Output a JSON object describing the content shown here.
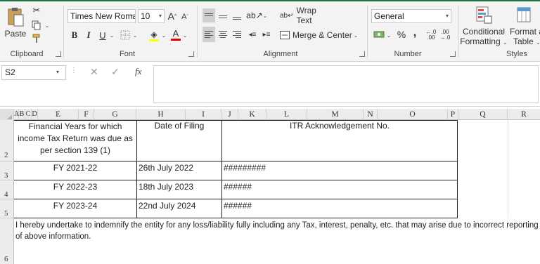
{
  "ribbon": {
    "clipboard": {
      "paste_label": "Paste",
      "group_label": "Clipboard"
    },
    "font": {
      "font_name": "Times New Romar",
      "font_size": "10",
      "bold": "B",
      "italic": "I",
      "underline": "U",
      "grow": "A",
      "shrink": "A",
      "group_label": "Font"
    },
    "alignment": {
      "wrap_text": "Wrap Text",
      "merge_center": "Merge & Center",
      "group_label": "Alignment"
    },
    "number": {
      "format": "General",
      "percent": "%",
      "comma": ",",
      "inc_decimal": "←.0 .00",
      "dec_decimal": ".00 →.0",
      "group_label": "Number"
    },
    "styles": {
      "conditional_line1": "Conditional",
      "conditional_line2": "Formatting",
      "table_line1": "Format as",
      "table_line2": "Table",
      "group_label": "Styles"
    }
  },
  "formula_bar": {
    "name_box": "S2",
    "fx": "fx",
    "value": ""
  },
  "columns": [
    "A",
    "B",
    "C",
    "D",
    "E",
    "F",
    "G",
    "H",
    "I",
    "J",
    "K",
    "L",
    "M",
    "N",
    "O",
    "P",
    "Q",
    "R"
  ],
  "rows": [
    "2",
    "3",
    "4",
    "5",
    "6"
  ],
  "table": {
    "header": {
      "fy_line1": "Financial Years for which",
      "fy_line2": "income Tax Return was due as",
      "fy_line3": "per section 139 (1)",
      "date": "Date of Filing",
      "ack": "ITR Acknowledgement No."
    },
    "rows": [
      {
        "fy": "FY 2021-22",
        "date": "26th July 2022",
        "ack": "#########"
      },
      {
        "fy": "FY 2022-23",
        "date": "18th July 2023",
        "ack": "######"
      },
      {
        "fy": "FY 2023-24",
        "date": "22nd July 2024",
        "ack": "######"
      }
    ]
  },
  "note": {
    "line1": "I hereby undertake to indemnify the entity for any loss/liability fully including any Tax, interest, penalty, etc. that may arise due to incorrect reporting",
    "line2": "of above information."
  }
}
